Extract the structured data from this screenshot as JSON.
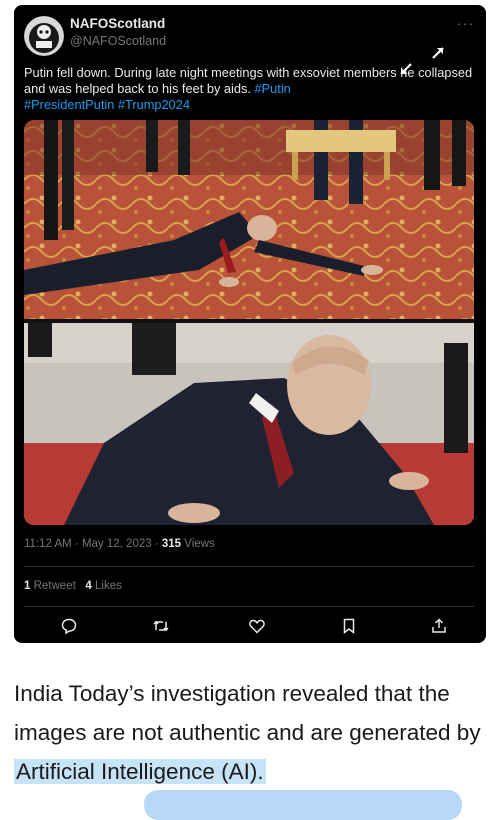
{
  "tweet": {
    "display_name": "NAFOScotland",
    "handle": "@NAFOScotland",
    "more_label": "···",
    "text_line1": "Putin fell down. During late night meetings with exsoviet members he",
    "text_line2": "collapsed and was helped back to his feet by aids.",
    "hashtag_putin": "#Putin",
    "hashtag_president": "#PresidentPutin",
    "hashtag_trump": "#Trump2024",
    "timestamp": "11:12 AM · May 12, 2023 · ",
    "views_count": "315",
    "views_label": " Views",
    "retweets_count": "1",
    "retweets_label": " Retweet",
    "likes_count": "4",
    "likes_label": " Likes",
    "hashtag_color": "#1d9bf0"
  },
  "article": {
    "text_before": "India Today’s investigation revealed that the images are not authentic and are generated by ",
    "highlight": "Artificial Intelligence (AI).",
    "highlight_color": "#c7e3f7"
  },
  "icons": [
    "reply-icon",
    "retweet-icon",
    "like-icon",
    "bookmark-icon",
    "share-icon",
    "expand-icon",
    "collapse-icon"
  ]
}
